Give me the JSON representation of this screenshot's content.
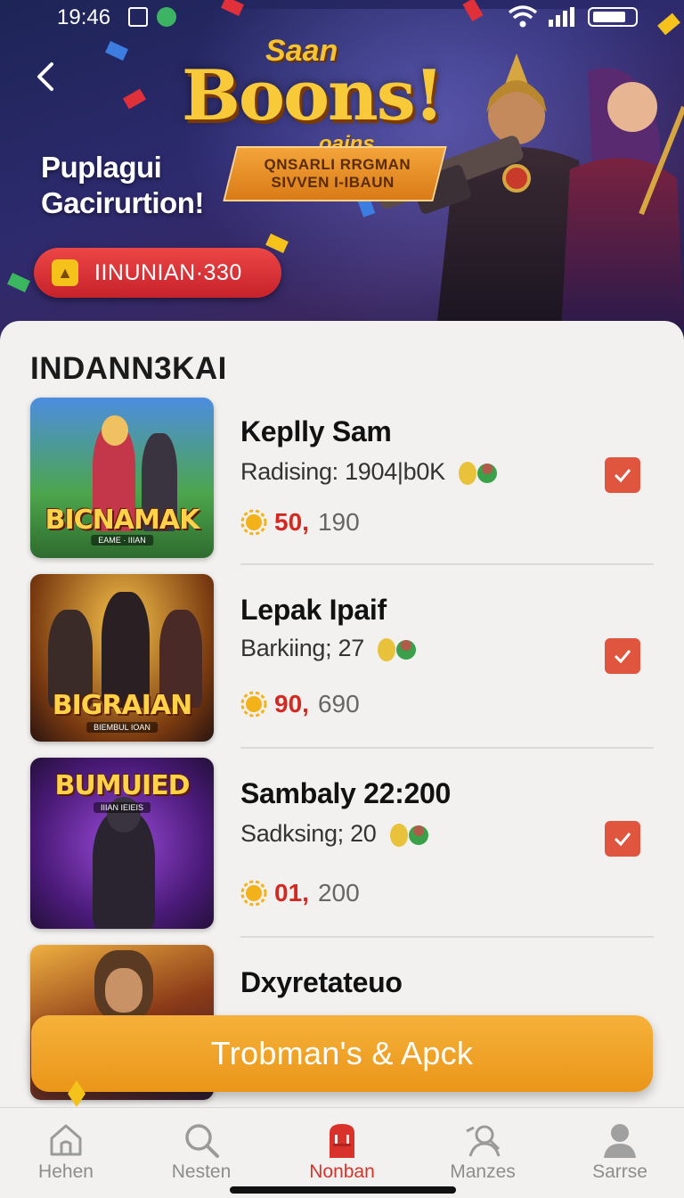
{
  "status_bar": {
    "time": "19:46"
  },
  "hero": {
    "logo_top": "Saan",
    "logo_main": "Boons!",
    "logo_tail": "oains",
    "ribbon_line1": "QNSARLI RRGMAN",
    "ribbon_line2": "SIVVEN I-IBAUN",
    "subtitle": "Puplagui Gacirurtion!",
    "pill_text": "IINUNIAN·330"
  },
  "section_title": "INDANN3KAI",
  "games": [
    {
      "name": "Keplly Sam",
      "rank": "Radising: 1904|b0K",
      "score_main": "50,",
      "score_secondary": "190",
      "thumb_title": "BICNAMAK",
      "thumb_sub": "EAME · IIIAN",
      "checked": true
    },
    {
      "name": "Lepak Ipaif",
      "rank": "Barkiing; 27",
      "score_main": "90,",
      "score_secondary": "690",
      "thumb_title": "BIGRAIAN",
      "thumb_sub": "BIEMBUL IOAN",
      "checked": true
    },
    {
      "name": "Sambaly 22:200",
      "rank": "Sadksing; 20",
      "score_main": "01,",
      "score_secondary": "200",
      "thumb_title": "BUMUIED",
      "thumb_sub": "IIIAN IEIEIS",
      "checked": true
    },
    {
      "name": "Dxyretateuo",
      "rank": "",
      "score_main": "",
      "score_secondary": "",
      "thumb_title": "",
      "thumb_sub": "",
      "checked": false
    }
  ],
  "cta_label": "Trobman's & Apck",
  "tabs": [
    {
      "label": "Hehen",
      "icon": "home-icon"
    },
    {
      "label": "Nesten",
      "icon": "search-icon"
    },
    {
      "label": "Nonban",
      "icon": "bag-icon",
      "active": true
    },
    {
      "label": "Manzes",
      "icon": "people-icon"
    },
    {
      "label": "Sarrse",
      "icon": "profile-icon"
    }
  ],
  "colors": {
    "accent": "#d8322a",
    "cta": "#f0a32a",
    "check": "#e0553d",
    "background": "#f2f1ef"
  }
}
